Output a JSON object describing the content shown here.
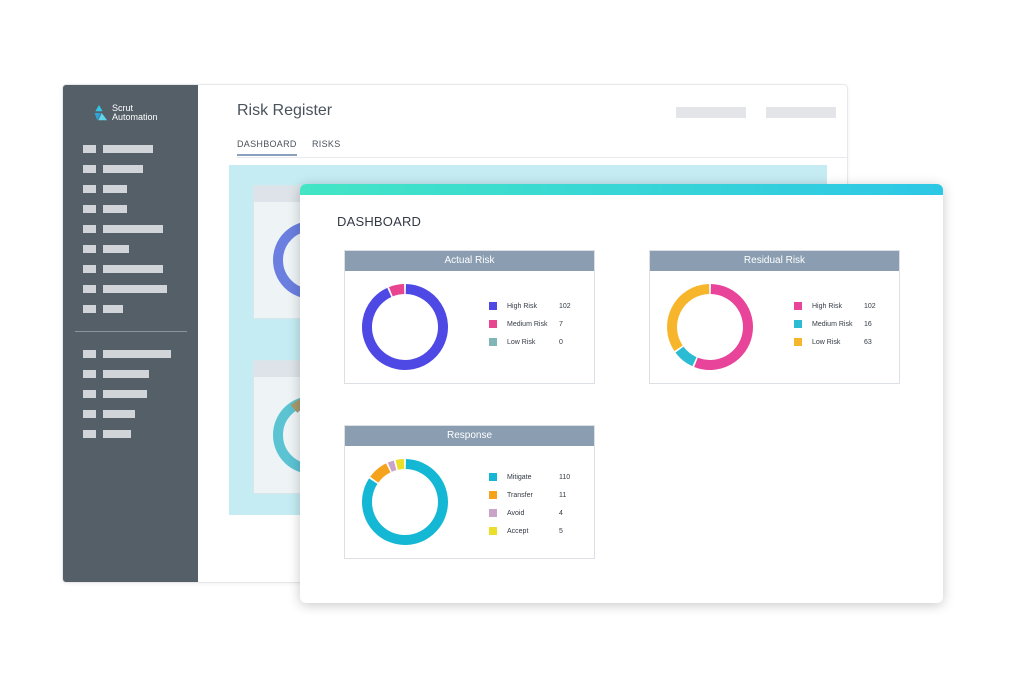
{
  "brand": {
    "line1": "Scrut",
    "line2": "Automation"
  },
  "back_window": {
    "title": "Risk Register",
    "tabs": [
      {
        "label": "DASHBOARD",
        "active": true
      },
      {
        "label": "RISKS",
        "active": false
      }
    ]
  },
  "dashboard": {
    "heading": "DASHBOARD",
    "cards": [
      {
        "title": "Actual Risk",
        "chart_data": {
          "type": "pie",
          "title": "Actual Risk",
          "categories": [
            "High Risk",
            "Medium Risk",
            "Low Risk"
          ],
          "values": [
            102,
            7,
            0
          ],
          "colors": [
            "#4e49e4",
            "#e8448f",
            "#7fb5b5"
          ]
        }
      },
      {
        "title": "Residual Risk",
        "chart_data": {
          "type": "pie",
          "title": "Residual Risk",
          "categories": [
            "High Risk",
            "Medium Risk",
            "Low Risk"
          ],
          "values": [
            102,
            16,
            63
          ],
          "colors": [
            "#e8449a",
            "#2bbcd4",
            "#f7b52c"
          ]
        }
      },
      {
        "title": "Response",
        "chart_data": {
          "type": "pie",
          "title": "Response",
          "categories": [
            "Mitigate",
            "Transfer",
            "Avoid",
            "Accept"
          ],
          "values": [
            110,
            11,
            4,
            5
          ],
          "colors": [
            "#14b8d4",
            "#f5a21c",
            "#c9a4c8",
            "#ecdf2a"
          ]
        }
      }
    ]
  }
}
